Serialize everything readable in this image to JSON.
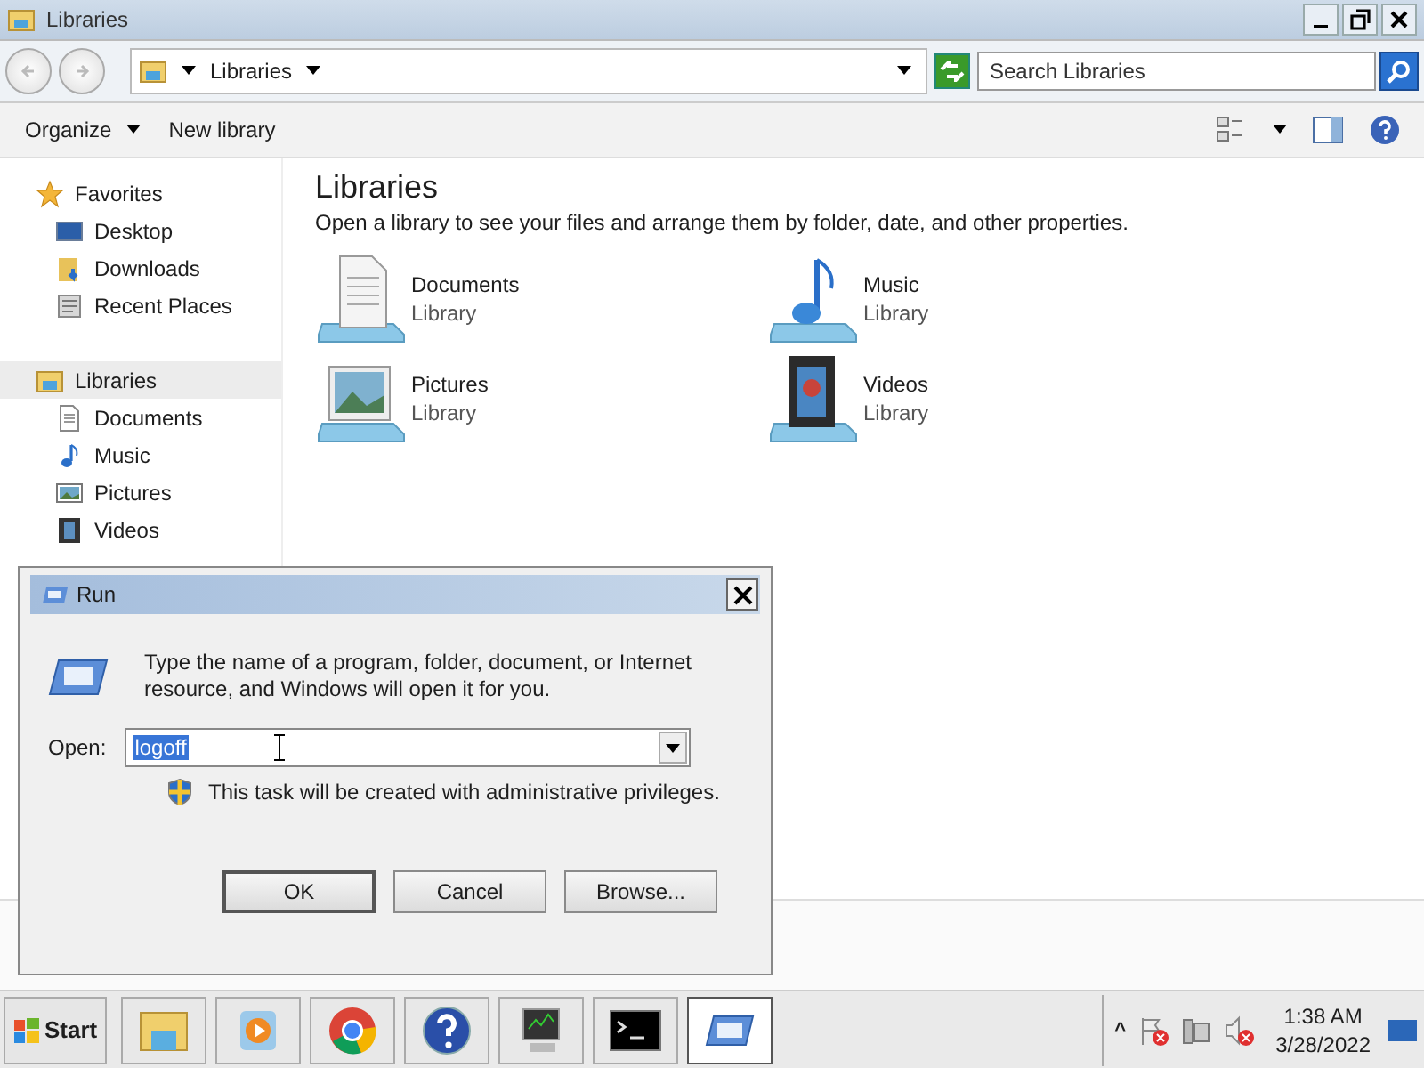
{
  "window": {
    "title": "Libraries"
  },
  "address": {
    "path": "Libraries"
  },
  "search": {
    "placeholder": "Search Libraries"
  },
  "commands": [
    {
      "label": "Organize",
      "menu": true
    },
    {
      "label": "New library",
      "menu": false
    }
  ],
  "sidebar": {
    "groups": [
      {
        "label": "Favorites",
        "kind": "star",
        "selected": false,
        "children": [
          {
            "label": "Desktop",
            "kind": "desktop"
          },
          {
            "label": "Downloads",
            "kind": "downloads"
          },
          {
            "label": "Recent Places",
            "kind": "recent"
          }
        ]
      },
      {
        "label": "Libraries",
        "kind": "libraries",
        "selected": true,
        "children": [
          {
            "label": "Documents",
            "kind": "documents"
          },
          {
            "label": "Music",
            "kind": "music"
          },
          {
            "label": "Pictures",
            "kind": "pictures"
          },
          {
            "label": "Videos",
            "kind": "videos"
          }
        ]
      }
    ]
  },
  "content": {
    "heading": "Libraries",
    "description": "Open a library to see your files and arrange them by folder, date, and other properties.",
    "libraries": [
      {
        "name": "Documents",
        "type": "Library",
        "kind": "documents"
      },
      {
        "name": "Music",
        "type": "Library",
        "kind": "music"
      },
      {
        "name": "Pictures",
        "type": "Library",
        "kind": "pictures"
      },
      {
        "name": "Videos",
        "type": "Library",
        "kind": "videos"
      }
    ]
  },
  "run_dialog": {
    "title": "Run",
    "message": "Type the name of a program, folder, document, or Internet resource, and Windows will open it for you.",
    "open_label": "Open:",
    "value": "logoff",
    "note": "This task will be created with administrative privileges.",
    "buttons": [
      "OK",
      "Cancel",
      "Browse..."
    ]
  },
  "taskbar": {
    "start": "Start",
    "items": [
      {
        "kind": "explorer",
        "selected": false
      },
      {
        "kind": "media",
        "selected": false
      },
      {
        "kind": "chrome",
        "selected": false
      },
      {
        "kind": "help",
        "selected": false
      },
      {
        "kind": "monitor",
        "selected": false
      },
      {
        "kind": "console",
        "selected": false
      },
      {
        "kind": "run",
        "selected": true
      }
    ],
    "tray_toggle": "^",
    "time": "1:38 AM",
    "date": "3/28/2022"
  }
}
